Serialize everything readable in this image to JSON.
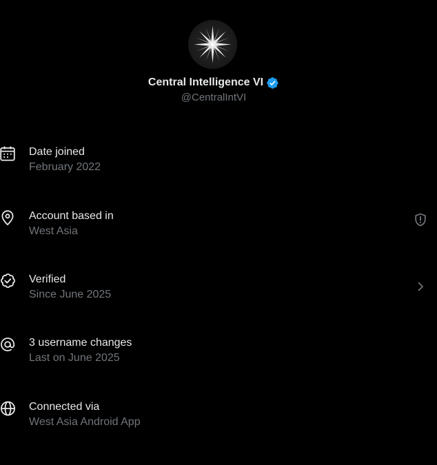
{
  "profile": {
    "display_name": "Central Intelligence VI",
    "handle": "@CentralIntVI",
    "avatar_icon": "compass-star-logo",
    "verified_icon": "verified-badge-icon",
    "verified_color": "#1d9bf0"
  },
  "rows": [
    {
      "icon": "calendar-icon",
      "title": "Date joined",
      "subtitle": "February 2022"
    },
    {
      "icon": "location-pin-icon",
      "title": "Account based in",
      "subtitle": "West Asia",
      "right_icon": "shield-alert-icon"
    },
    {
      "icon": "verified-outline-icon",
      "title": "Verified",
      "subtitle": "Since June 2025",
      "right_icon": "chevron-right-icon"
    },
    {
      "icon": "at-sign-icon",
      "title": "3 username changes",
      "subtitle": "Last on June 2025"
    },
    {
      "icon": "globe-icon",
      "title": "Connected via",
      "subtitle": "West Asia Android App"
    }
  ],
  "colors": {
    "background": "#000000",
    "primary_text": "#e7e9ea",
    "secondary_text": "#71767b",
    "accent": "#1d9bf0"
  }
}
